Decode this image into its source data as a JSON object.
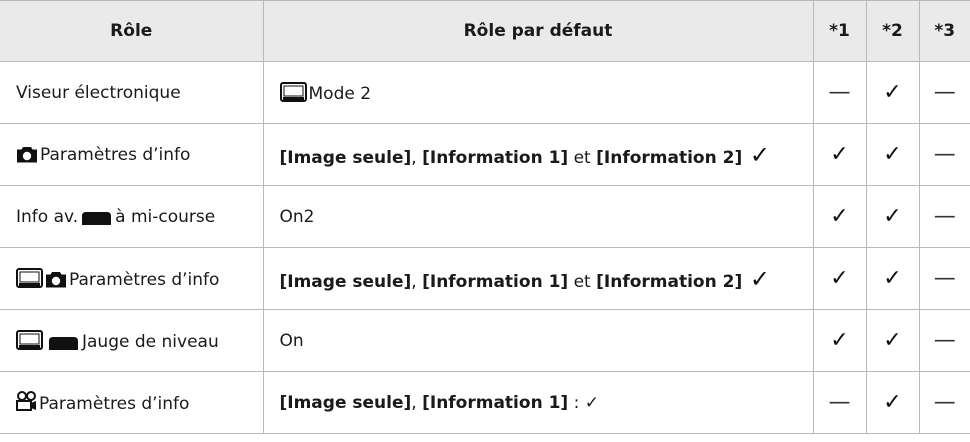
{
  "header": {
    "role": "Rôle",
    "default_role": "Rôle par défaut",
    "c1": "*1",
    "c2": "*2",
    "c3": "*3"
  },
  "marks": {
    "check": "✓",
    "dash": "—"
  },
  "rows": [
    {
      "role": "Viseur électronique",
      "default_text": "Mode 2",
      "c1": "—",
      "c2": "✓",
      "c3": "—"
    },
    {
      "role": "Paramètres d’info",
      "default_parts": [
        "[Image seule]",
        ", ",
        "[Information 1]",
        " et ",
        "[Information 2]",
        " ✓"
      ],
      "c1": "✓",
      "c2": "✓",
      "c3": "—"
    },
    {
      "role_before": "Info av.",
      "role_after": "à mi-course",
      "default_text": "On2",
      "c1": "✓",
      "c2": "✓",
      "c3": "—"
    },
    {
      "role": "Paramètres d’info",
      "default_parts": [
        "[Image seule]",
        ", ",
        "[Information 1]",
        " et ",
        "[Information 2]",
        " ✓"
      ],
      "c1": "✓",
      "c2": "✓",
      "c3": "—"
    },
    {
      "role": "Jauge de niveau",
      "default_text": "On",
      "c1": "✓",
      "c2": "✓",
      "c3": "—"
    },
    {
      "role": "Paramètres d’info",
      "default_parts": [
        "[Image seule]",
        ", ",
        "[Information 1]",
        " : ✓"
      ],
      "c1": "—",
      "c2": "✓",
      "c3": "—"
    }
  ],
  "icons": [
    "camera-icon",
    "evf-monitor-icon",
    "shutter-button-icon",
    "movie-camera-icon"
  ]
}
